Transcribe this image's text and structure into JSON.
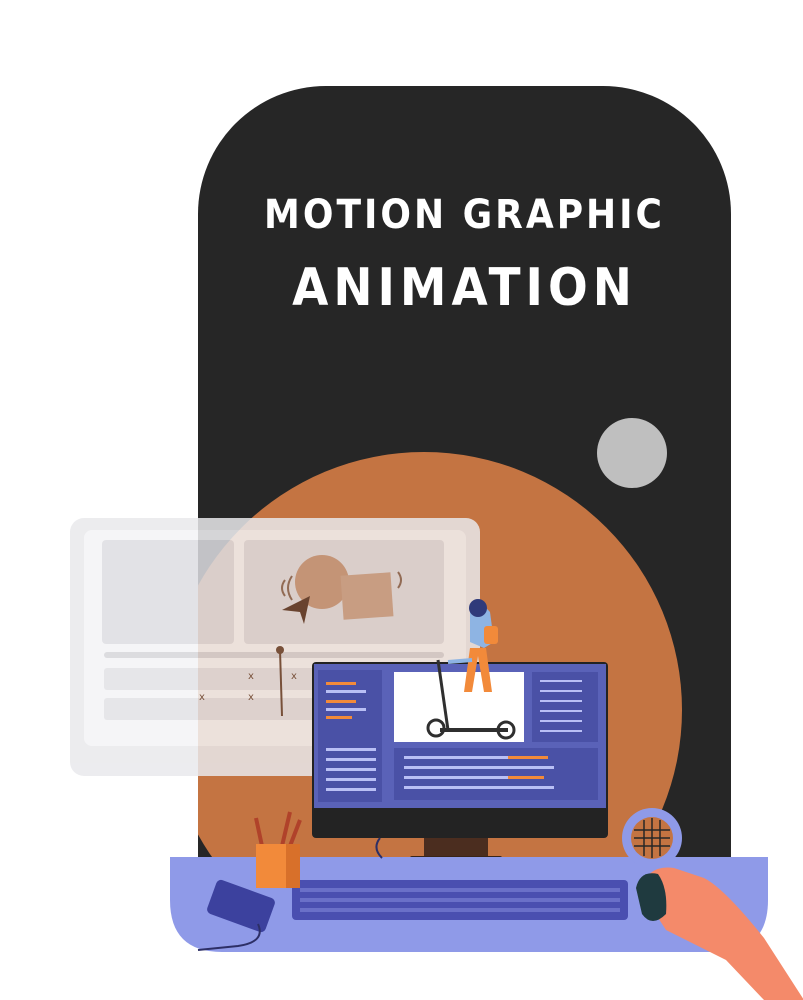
{
  "heading": {
    "line1": "MOTION GRAPHIC",
    "line2": "ANIMATION"
  },
  "colors": {
    "background": "#ffffff",
    "panel": "#262626",
    "orange_circle": "#c47442",
    "desk": "#8f9ae8",
    "monitor_screen": "#5a62b8",
    "accent_orange": "#f28a3a"
  },
  "icons": [
    "cursor-arrow-icon",
    "pencil-cup-icon",
    "phone-icon",
    "keyboard-icon",
    "mouse-icon",
    "hand-icon",
    "scooter-rider-icon",
    "waffle-ball-icon"
  ]
}
